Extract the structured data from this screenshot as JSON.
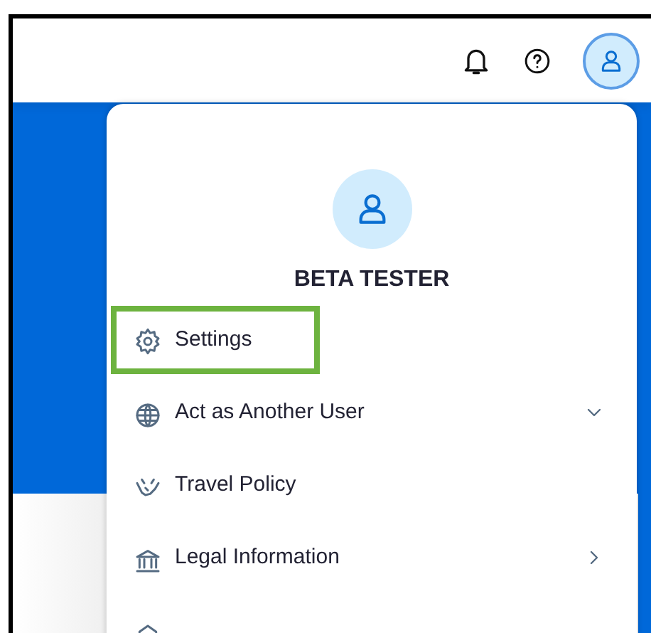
{
  "user_menu": {
    "open": true,
    "user_name": "BETA TESTER",
    "items": [
      {
        "label": "Settings",
        "kind": "plain",
        "highlighted": true
      },
      {
        "label": "Act as Another User",
        "kind": "expand",
        "highlighted": false
      },
      {
        "label": "Travel Policy",
        "kind": "plain",
        "highlighted": false
      },
      {
        "label": "Legal Information",
        "kind": "submenu",
        "highlighted": false
      },
      {
        "kind": "plain",
        "highlighted": false
      }
    ]
  }
}
